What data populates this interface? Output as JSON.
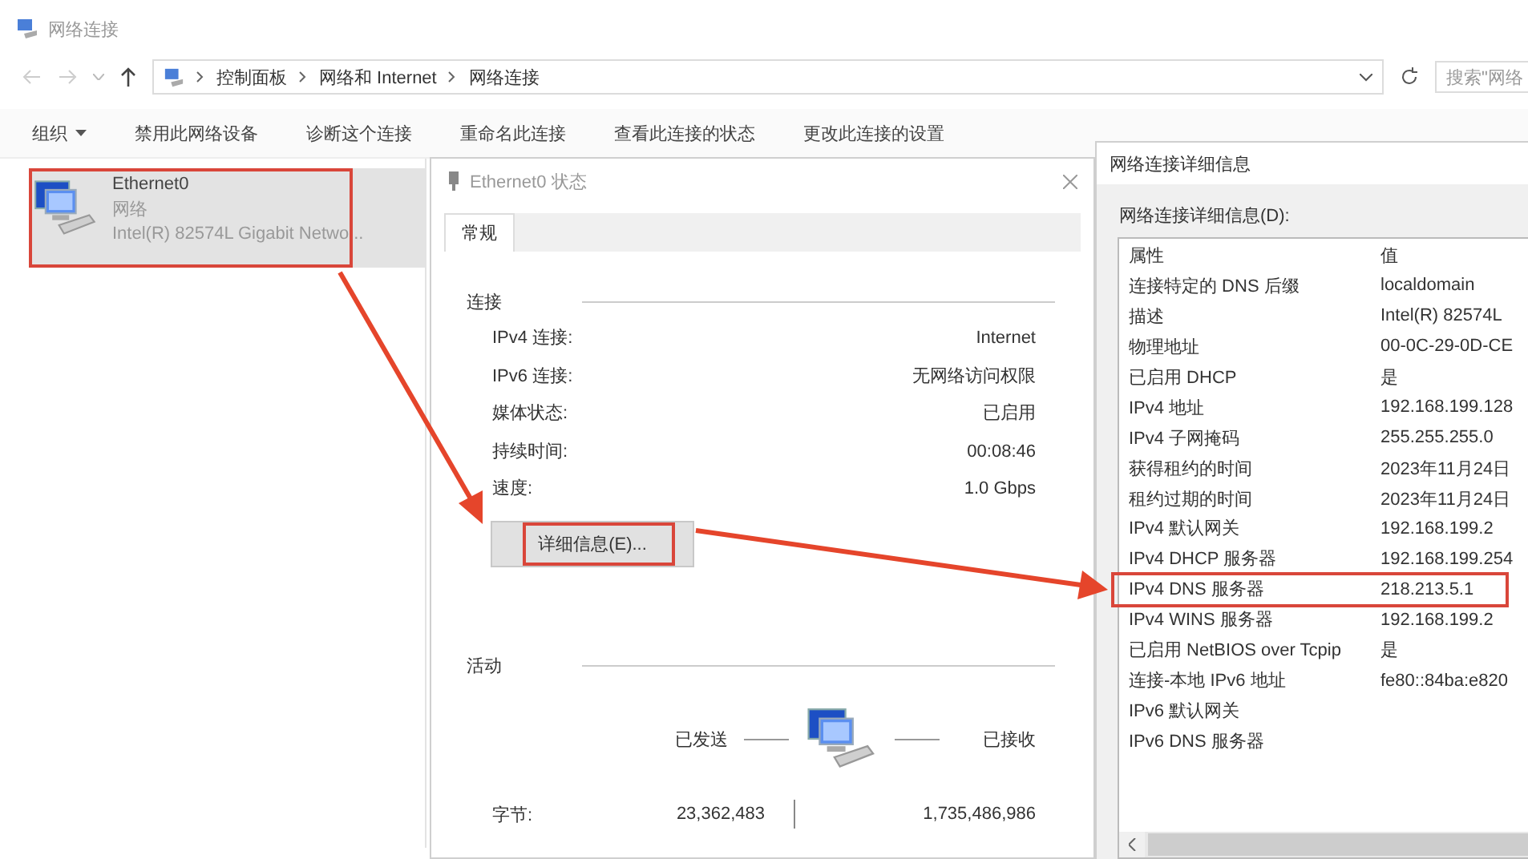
{
  "window": {
    "title": "网络连接"
  },
  "address_bar": {
    "path": [
      "控制面板",
      "网络和 Internet",
      "网络连接"
    ],
    "search_placeholder": "搜索\"网络"
  },
  "toolbar": [
    {
      "label": "组织",
      "dropdown": true
    },
    {
      "label": "禁用此网络设备",
      "dropdown": false
    },
    {
      "label": "诊断这个连接",
      "dropdown": false
    },
    {
      "label": "重命名此连接",
      "dropdown": false
    },
    {
      "label": "查看此连接的状态",
      "dropdown": false
    },
    {
      "label": "更改此连接的设置",
      "dropdown": false
    }
  ],
  "connections": [
    {
      "name": "Ethernet0",
      "network": "网络",
      "adapter": "Intel(R) 82574L Gigabit Netwo...",
      "selected": true,
      "highlighted": true
    }
  ],
  "status_dialog": {
    "title": "Ethernet0 状态",
    "tabs": [
      {
        "label": "常规",
        "selected": true
      }
    ],
    "connection_group": "连接",
    "connection_rows": [
      {
        "label": "IPv4 连接:",
        "value": "Internet"
      },
      {
        "label": "IPv6 连接:",
        "value": "无网络访问权限"
      },
      {
        "label": "媒体状态:",
        "value": "已启用"
      },
      {
        "label": "持续时间:",
        "value": "00:08:46"
      },
      {
        "label": "速度:",
        "value": "1.0 Gbps"
      }
    ],
    "details_button": {
      "label": "详细信息(E)...",
      "highlighted": true
    },
    "activity_group": "活动",
    "sent_label": "已发送",
    "received_label": "已接收",
    "bytes_label": "字节:",
    "bytes_sent": "23,362,483",
    "bytes_received": "1,735,486,986"
  },
  "details_dialog": {
    "title": "网络连接详细信息",
    "list_label": "网络连接详细信息(D):",
    "columns": [
      "属性",
      "值"
    ],
    "rows": [
      {
        "property": "连接特定的 DNS 后缀",
        "value": "localdomain",
        "highlighted": false
      },
      {
        "property": "描述",
        "value": "Intel(R) 82574L",
        "highlighted": false
      },
      {
        "property": "物理地址",
        "value": "00-0C-29-0D-CE",
        "highlighted": false
      },
      {
        "property": "已启用 DHCP",
        "value": "是",
        "highlighted": false
      },
      {
        "property": "IPv4 地址",
        "value": "192.168.199.128",
        "highlighted": false
      },
      {
        "property": "IPv4 子网掩码",
        "value": "255.255.255.0",
        "highlighted": false
      },
      {
        "property": "获得租约的时间",
        "value": "2023年11月24日",
        "highlighted": false
      },
      {
        "property": "租约过期的时间",
        "value": "2023年11月24日",
        "highlighted": false
      },
      {
        "property": "IPv4 默认网关",
        "value": "192.168.199.2",
        "highlighted": false
      },
      {
        "property": "IPv4 DHCP 服务器",
        "value": "192.168.199.254",
        "highlighted": false
      },
      {
        "property": "IPv4 DNS 服务器",
        "value": "218.213.5.1",
        "highlighted": true
      },
      {
        "property": "IPv4 WINS 服务器",
        "value": "192.168.199.2",
        "highlighted": false
      },
      {
        "property": "已启用 NetBIOS over Tcpip",
        "value": "是",
        "highlighted": false
      },
      {
        "property": "连接-本地 IPv6 地址",
        "value": "fe80::84ba:e820",
        "highlighted": false
      },
      {
        "property": "IPv6 默认网关",
        "highlighted": false
      },
      {
        "property": "IPv6 DNS 服务器",
        "highlighted": false
      }
    ]
  }
}
